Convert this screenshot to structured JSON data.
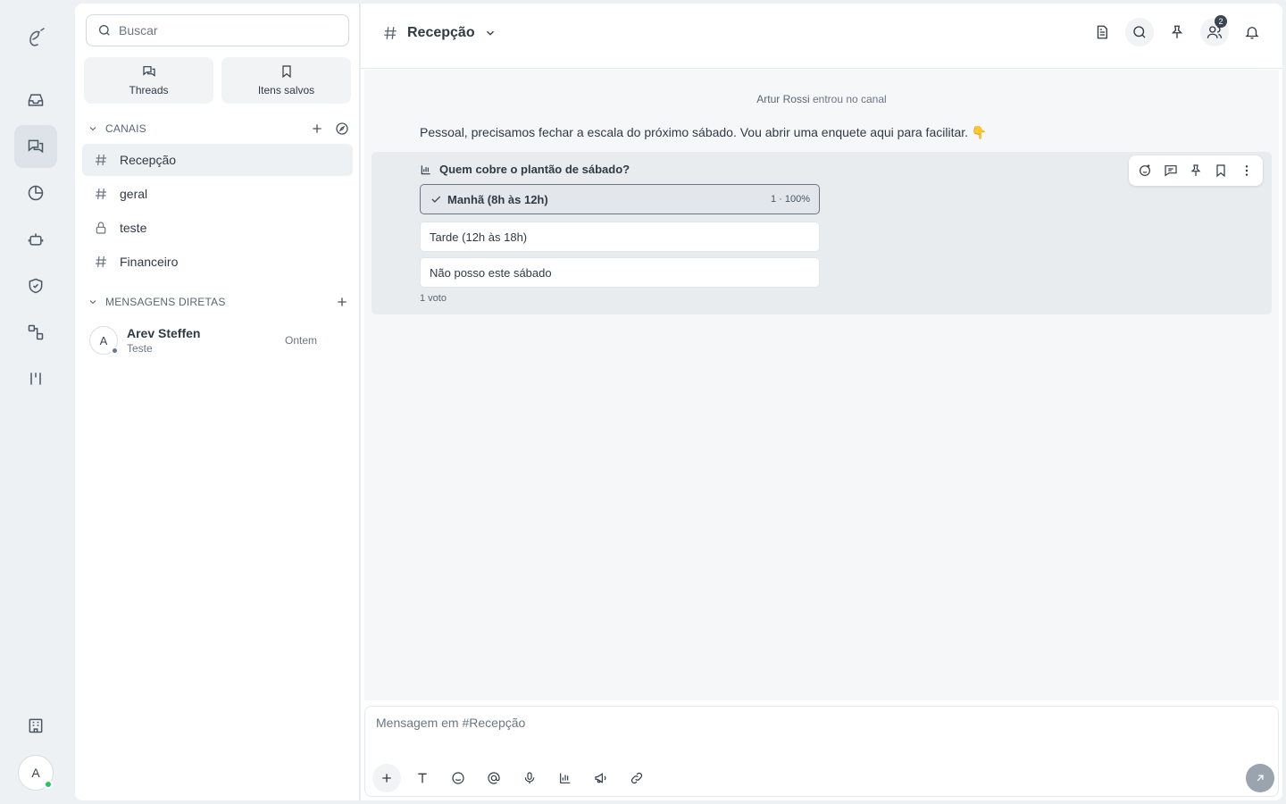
{
  "sidebar": {
    "search_placeholder": "Buscar",
    "quick": [
      {
        "label": "Threads",
        "icon": "threads-icon"
      },
      {
        "label": "Itens salvos",
        "icon": "bookmark-icon"
      }
    ],
    "channels_header": "CANAIS",
    "channels": [
      {
        "name": "Recepção",
        "icon": "hash-icon",
        "active": true
      },
      {
        "name": "geral",
        "icon": "hash-icon"
      },
      {
        "name": "teste",
        "icon": "lock-icon"
      },
      {
        "name": "Financeiro",
        "icon": "hash-icon"
      }
    ],
    "dm_header": "MENSAGENS DIRETAS",
    "dms": [
      {
        "initial": "A",
        "name": "Arev Steffen",
        "preview": "Teste",
        "time": "Ontem"
      }
    ]
  },
  "rail": {
    "avatar_initial": "A"
  },
  "header": {
    "channel_name": "Recepção",
    "members_badge": "2"
  },
  "messages": {
    "system_user": "Artur Rossi",
    "system_text": "entrou no canal",
    "message_text": "Pessoal, precisamos fechar a escala do próximo sábado. Vou abrir uma enquete aqui para facilitar. 👇",
    "poll": {
      "question": "Quem cobre o plantão de sábado?",
      "options": [
        {
          "label": "Manhã (8h às 12h)",
          "result": "1 · 100%",
          "selected": true,
          "share": 1.0
        },
        {
          "label": "Tarde (12h às 18h)",
          "selected": false,
          "share": 0
        },
        {
          "label": "Não posso este sábado",
          "selected": false,
          "share": 0
        }
      ],
      "votes": "1 voto"
    }
  },
  "composer": {
    "placeholder": "Mensagem em #Recepção"
  }
}
